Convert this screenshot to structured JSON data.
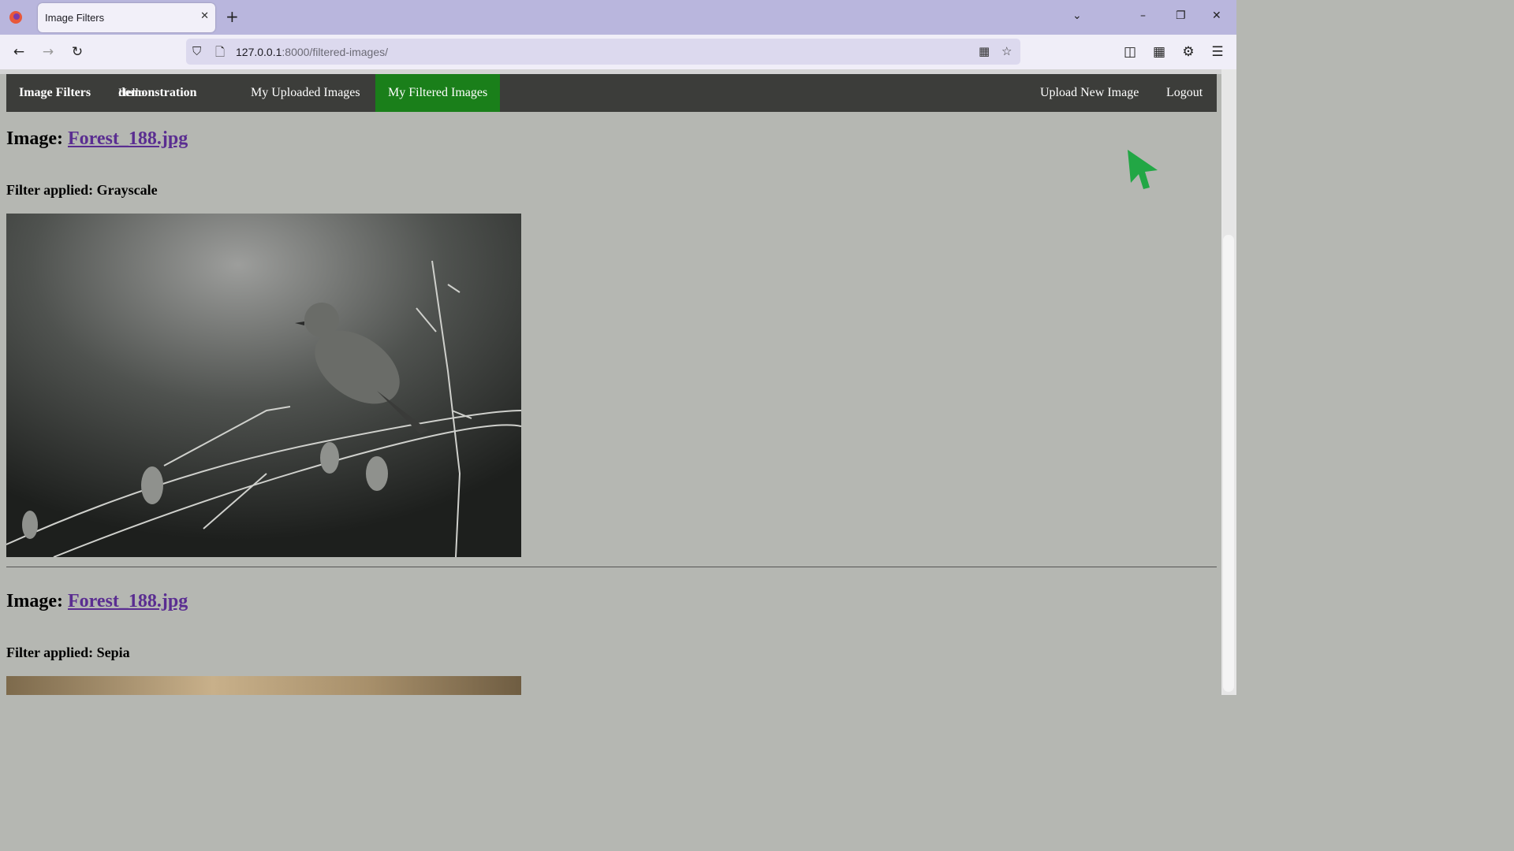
{
  "browser": {
    "tab_title": "Image Filters",
    "url_host": "127.0.0.1",
    "url_rest": ":8000/filtered-images/"
  },
  "nav": {
    "brand": "Image Filters",
    "hello_prefix": "Hello",
    "username": "demonstration",
    "uploaded": "My Uploaded Images",
    "filtered": "My Filtered Images",
    "upload_new": "Upload New Image",
    "logout": "Logout"
  },
  "entries": [
    {
      "image_label": "Image:",
      "file": "Forest_188.jpg",
      "filter_label": "Filter applied:",
      "filter": "Grayscale"
    },
    {
      "image_label": "Image:",
      "file": "Forest_188.jpg",
      "filter_label": "Filter applied:",
      "filter": "Sepia"
    }
  ],
  "colors": {
    "nav_bg": "#3c3d3a",
    "active": "#1a7f1a",
    "link": "#5a2d91",
    "page_bg": "#b5b7b2"
  }
}
